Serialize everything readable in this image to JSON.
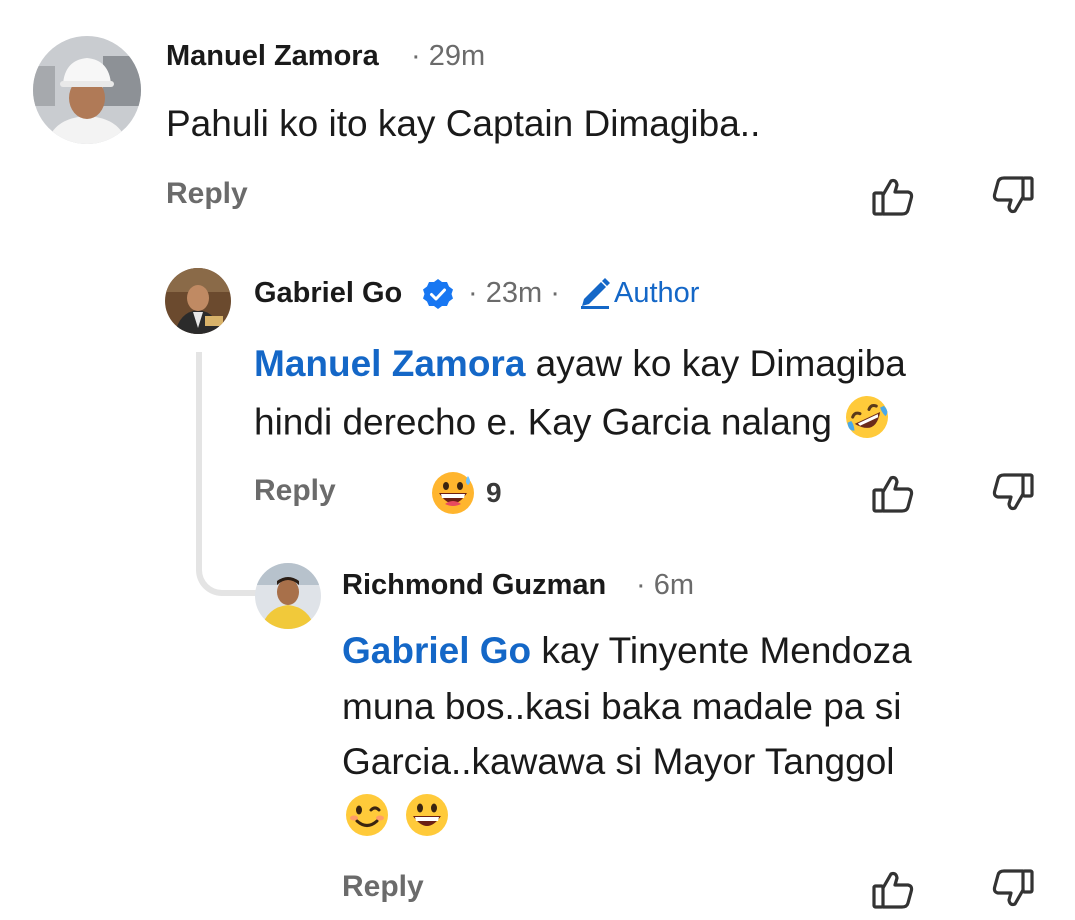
{
  "comments": [
    {
      "author": "Manuel Zamora",
      "time": "29m",
      "text": "Pahuli ko ito kay Captain Dimagiba..",
      "reply_label": "Reply",
      "avatar_icon": "avatar-hardhat-man"
    },
    {
      "author": "Gabriel Go",
      "verified_icon": "verified-badge-icon",
      "time": "23m",
      "author_tag": "Author",
      "author_tag_icon": "pencil-icon",
      "mention": "Manuel Zamora",
      "text_line1": " ayaw ko kay Dimagiba",
      "text_line2": "hindi derecho e. Kay Garcia nalang",
      "trailing_emoji": "rolling-on-floor-laughing-emoji",
      "reply_label": "Reply",
      "reaction_icon": "grinning-sweat-emoji",
      "reaction_count": "9",
      "avatar_icon": "avatar-man-desk"
    },
    {
      "author": "Richmond Guzman",
      "time": "6m",
      "mention": "Gabriel Go",
      "text_line1": " kay Tinyente Mendoza",
      "text_line2": "muna bos..kasi baka madale pa si",
      "text_line3": "Garcia..kawawa si Mayor Tanggol",
      "trailing_emojis": [
        "winking-face-emoji",
        "grinning-face-emoji"
      ],
      "reply_label": "Reply",
      "avatar_icon": "avatar-man-yellow-shirt"
    }
  ],
  "separator": "·",
  "colors": {
    "mention": "#1467c7",
    "meta": "#6b6b6b",
    "text": "#1a1a1a",
    "thread_line": "#e4e4e4"
  }
}
